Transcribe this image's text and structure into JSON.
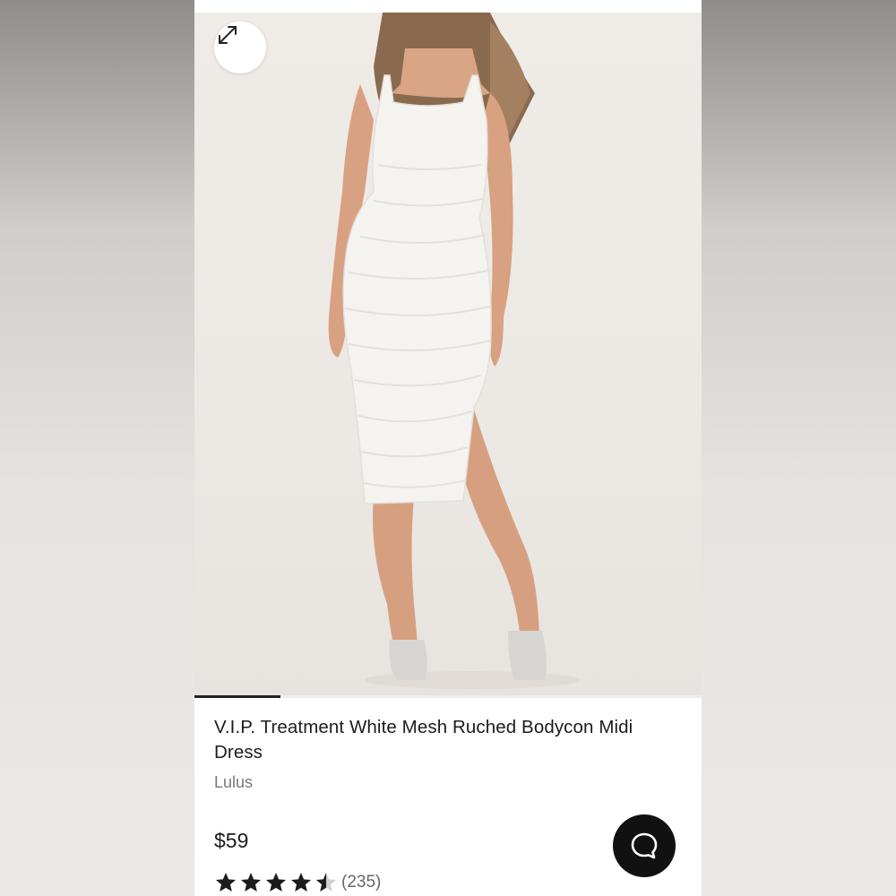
{
  "product": {
    "title": "V.I.P. Treatment White Mesh Ruched Bodycon Midi Dress",
    "brand": "Lulus",
    "price": "$59",
    "rating": 4.5,
    "review_count": "(235)"
  },
  "gallery": {
    "progress": 0.17
  },
  "icons": {
    "expand": "expand-arrows-icon",
    "chat": "chat-bubble-icon",
    "star": "star-icon"
  },
  "colors": {
    "text": "#1c1c1c",
    "muted": "#777777",
    "accent_dark": "#111111",
    "dress": "#f4f3ef"
  }
}
